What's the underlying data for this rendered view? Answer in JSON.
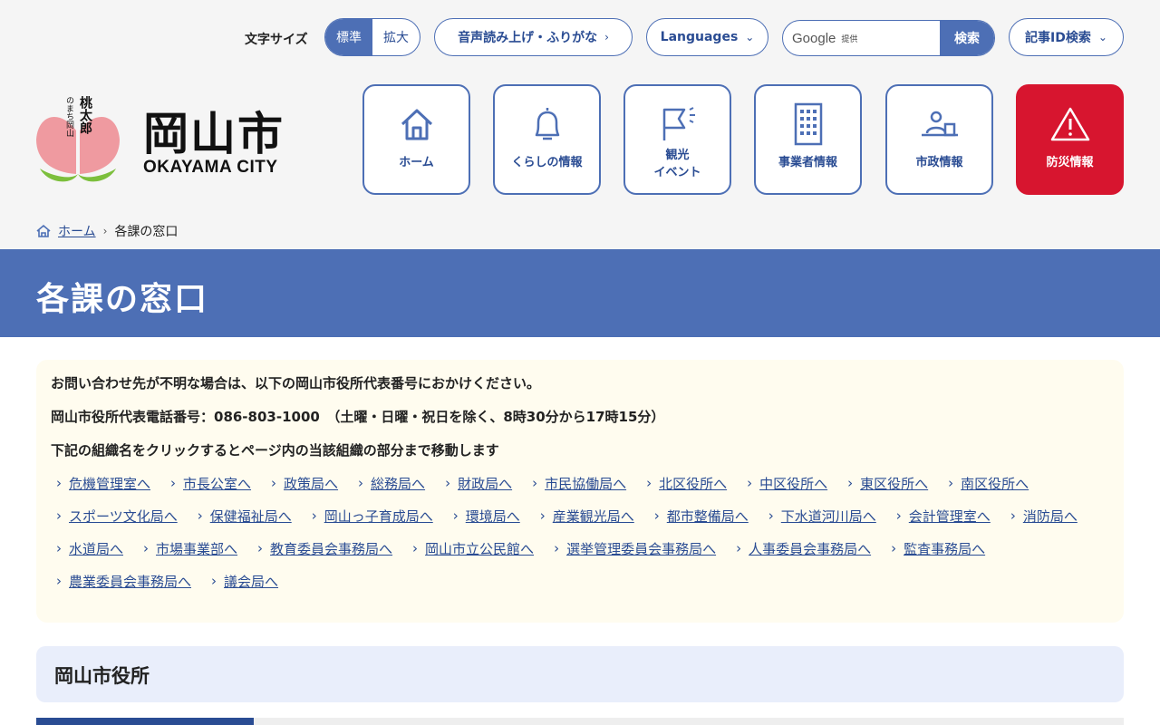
{
  "utility": {
    "font_size_label": "文字サイズ",
    "font_size_standard": "標準",
    "font_size_large": "拡大",
    "read_aloud": "音声読み上げ・ふりがな",
    "languages": "Languages",
    "search_brand": "Google",
    "search_provided": "提供",
    "search_button": "検索",
    "article_id_search": "記事ID検索"
  },
  "logo": {
    "name_jp": "岡山市",
    "name_en": "OKAYAMA CITY",
    "tagline_main": "桃太郎",
    "tagline_sub": "のまち岡山"
  },
  "nav": [
    {
      "label": "ホーム",
      "icon": "home-icon"
    },
    {
      "label": "くらしの情報",
      "icon": "bell-icon"
    },
    {
      "label": "観光\nイベント",
      "icon": "flag-icon"
    },
    {
      "label": "事業者情報",
      "icon": "building-icon"
    },
    {
      "label": "市政情報",
      "icon": "speaker-podium-icon"
    },
    {
      "label": "防災情報",
      "icon": "warning-icon"
    }
  ],
  "breadcrumb": {
    "home": "ホーム",
    "current": "各課の窓口"
  },
  "page_title": "各課の窓口",
  "notice": {
    "line1": "お問い合わせ先が不明な場合は、以下の岡山市役所代表番号におかけください。",
    "line2": "岡山市役所代表電話番号：086-803-1000　（土曜・日曜・祝日を除く、8時30分から17時15分）",
    "line3": "下記の組織名をクリックするとページ内の当該組織の部分まで移動します"
  },
  "dept_links": [
    "危機管理室へ",
    "市長公室へ",
    "政策局へ",
    "総務局へ",
    "財政局へ",
    "市民協働局へ",
    "北区役所へ",
    "中区役所へ",
    "東区役所へ",
    "南区役所へ",
    "スポーツ文化局へ",
    "保健福祉局へ",
    "岡山っ子育成局へ",
    "環境局へ",
    "産業観光局へ",
    "都市整備局へ",
    "下水道河川局へ",
    "会計管理室へ",
    "消防局へ",
    "水道局へ",
    "市場事業部へ",
    "教育委員会事務局へ",
    "岡山市立公民館へ",
    "選挙管理委員会事務局へ",
    "人事委員会事務局へ",
    "監査事務局へ",
    "農業委員会事務局へ",
    "議会局へ"
  ],
  "section_title": "岡山市役所",
  "colors": {
    "primary": "#4d6fb5",
    "link": "#2a4c93",
    "danger": "#d7152f",
    "notice_bg": "#fffcef",
    "section_bg": "#e9eefb"
  }
}
